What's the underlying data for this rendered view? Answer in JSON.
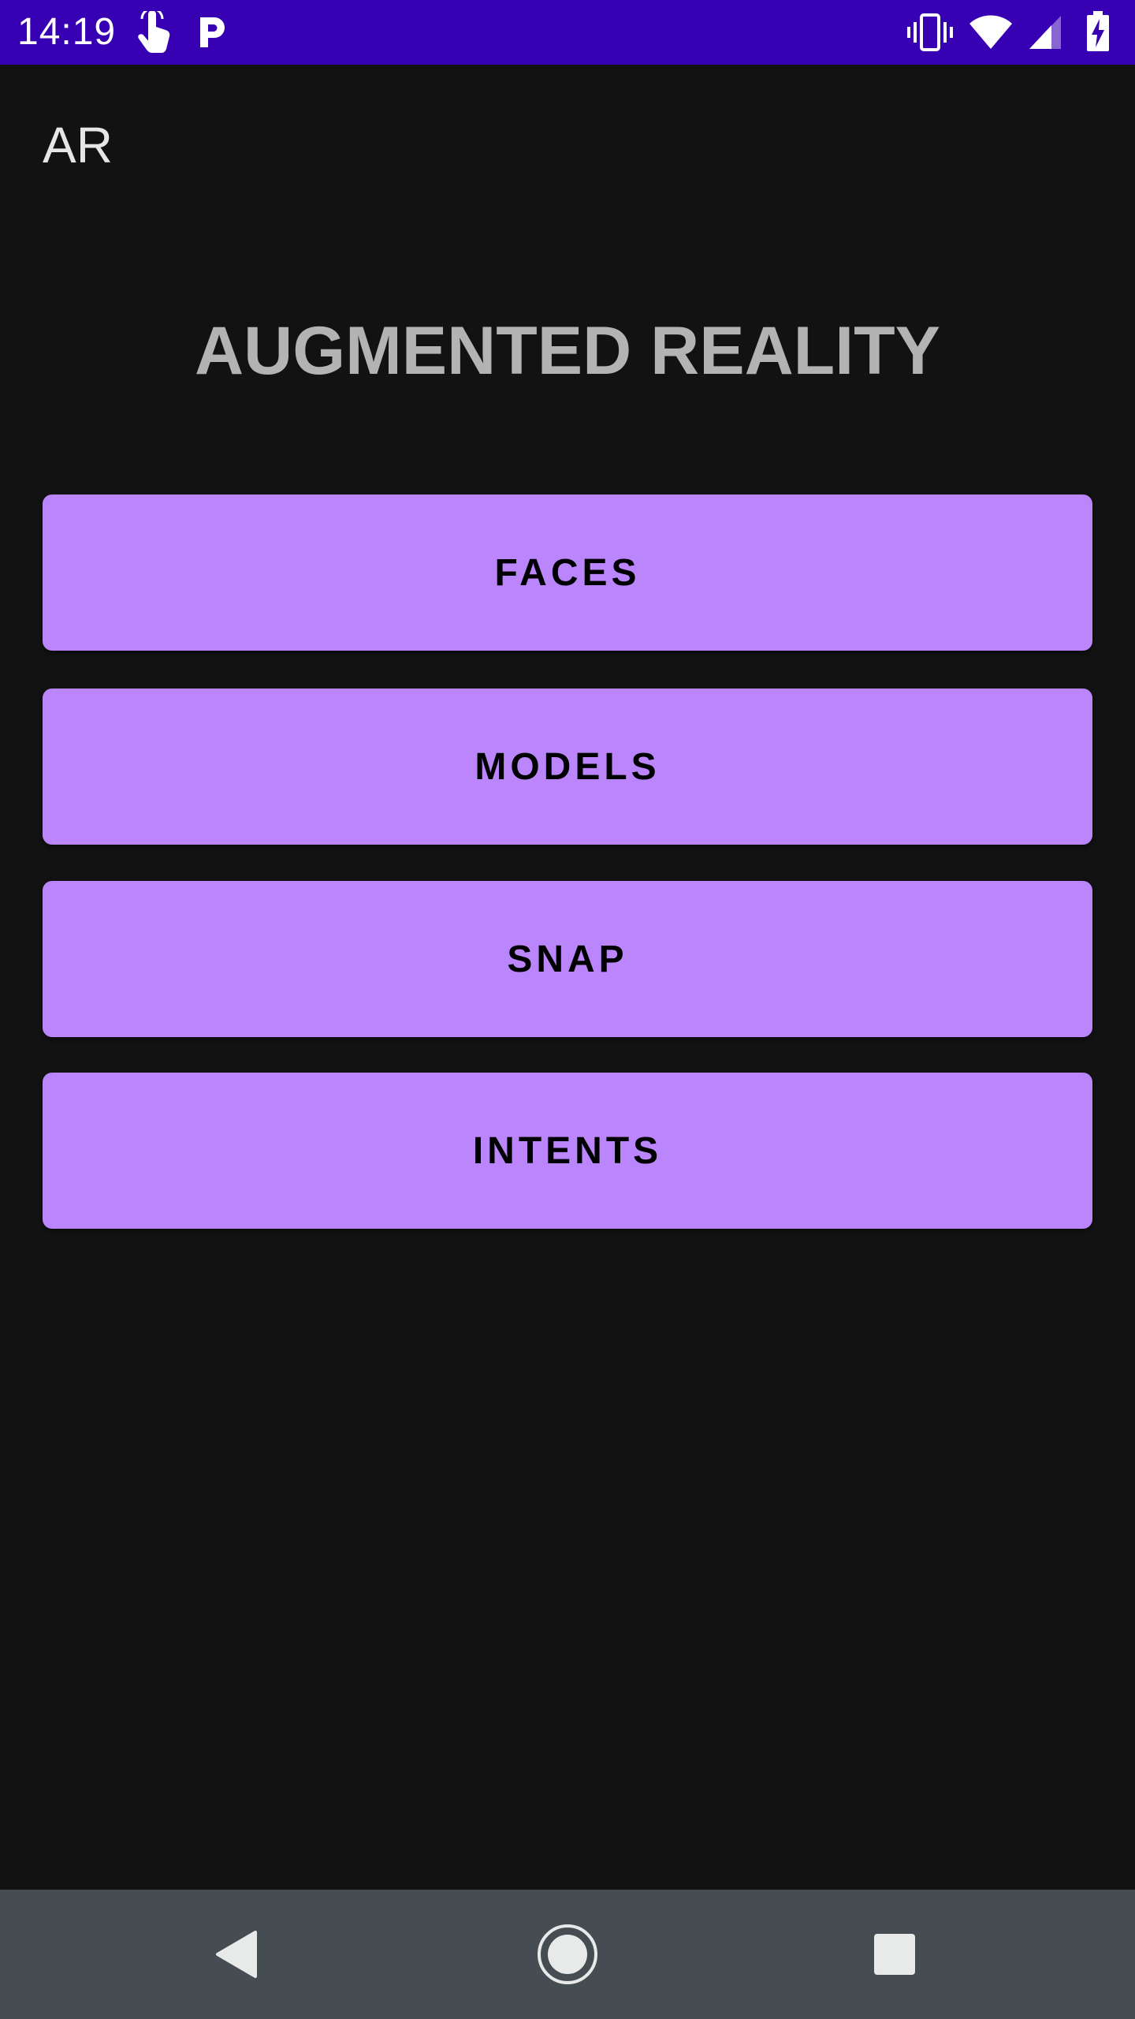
{
  "status_bar": {
    "time": "14:19",
    "background": "#3700b3",
    "left_icons": [
      "touch-icon",
      "parking-icon"
    ],
    "right_icons": [
      "vibrate-icon",
      "wifi-icon",
      "cell-signal-icon",
      "battery-charging-icon"
    ]
  },
  "app_bar": {
    "title": "AR"
  },
  "main": {
    "headline": "AUGMENTED REALITY",
    "buttons": [
      {
        "label": "FACES"
      },
      {
        "label": "MODELS"
      },
      {
        "label": "SNAP"
      },
      {
        "label": "INTENTS"
      }
    ],
    "button_color": "#bb86fc",
    "background": "#121212"
  },
  "nav_bar": {
    "background": "#464d52",
    "buttons": [
      "back-icon",
      "home-icon",
      "recents-icon"
    ]
  }
}
